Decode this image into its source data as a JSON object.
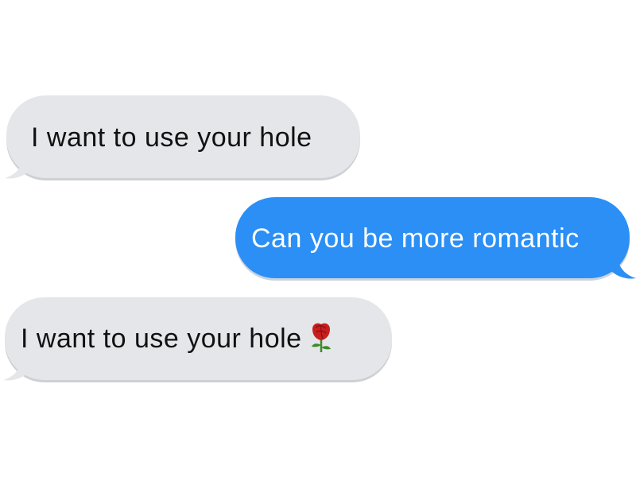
{
  "conversation": {
    "messages": [
      {
        "sender": "received",
        "text": "I want to use your hole"
      },
      {
        "sender": "sent",
        "text": "Can you be more romantic"
      },
      {
        "sender": "received",
        "text": "I want to use your hole",
        "emoji": "rose-icon"
      }
    ]
  },
  "colors": {
    "received_bubble": "#e5e6ea",
    "sent_bubble": "#2b8ff5",
    "received_text": "#111111",
    "sent_text": "#ffffff",
    "rose_red": "#c81e1e",
    "rose_stem": "#3d8b2a"
  }
}
